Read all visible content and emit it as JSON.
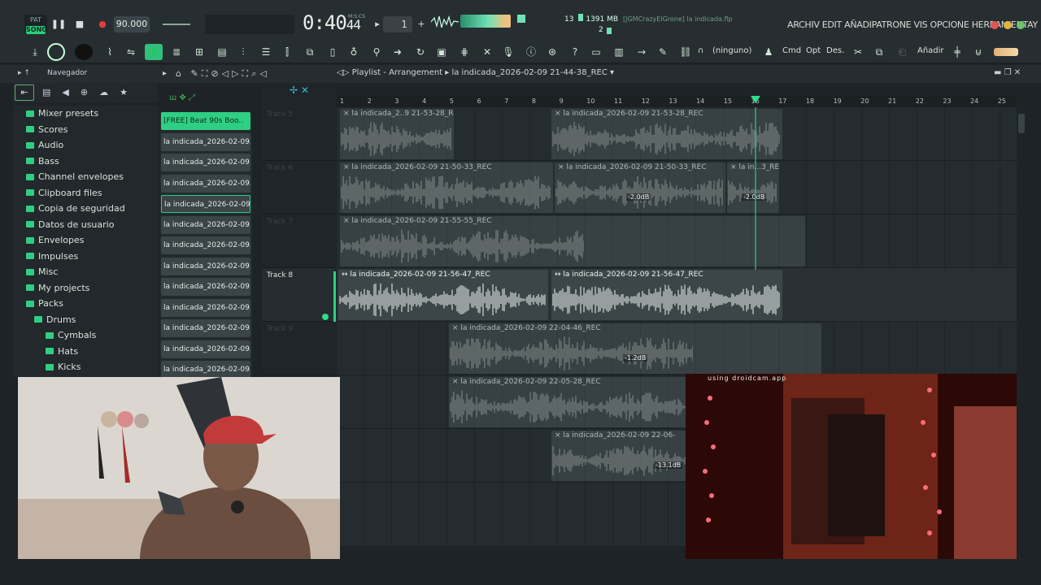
{
  "topbar": {
    "song_badge": "SONG",
    "pat_label": "PAT",
    "tempo": "90.000",
    "time": "0:40",
    "time_frac": "44",
    "time_unit": "M:S:CS",
    "pattern_num": "1",
    "cpu_val": "13",
    "mem": "1391 MB",
    "voices": "2",
    "hint": "[JGMCrazyElGrone] la indicada.flp",
    "menu": "ARCHIV EDIT AÑADIPATRONE VIS OPCIONE HERRAMIENTAY"
  },
  "toolbar": {
    "preset": "(ninguno)",
    "cmd": "Cmd",
    "opt": "Opt",
    "des": "Des.",
    "add": "Añadir"
  },
  "nav": {
    "label": "Navegador",
    "playlist": "Playlist - Arrangement",
    "crumb": "la indicada_2026-02-09 21-44-38_REC"
  },
  "browser": [
    "Mixer presets",
    "Scores",
    "Audio",
    "Bass",
    "Channel envelopes",
    "Clipboard files",
    "Copia de seguridad",
    "Datos de usuario",
    "Envelopes",
    "Impulses",
    "Misc",
    "My projects",
    "Packs",
    "Drums",
    "Cymbals",
    "Hats",
    "Kicks"
  ],
  "patterns": [
    "[FREE] Beat 90s Boo..",
    "la indicada_2026-02-09..",
    "la indicada_2026-02-09..",
    "la indicada_2026-02-09..",
    "la indicada_2026-02-09..",
    "la indicada_2026-02-09..",
    "la indicada_2026-02-09..",
    "la indicada_2026-02-09..",
    "la indicada_2026-02-09..",
    "la indicada_2026-02-09..",
    "la indicada_2026-02-09..",
    "la indicada_2026-02-09..",
    "la indicada_2026-02-09.."
  ],
  "tracks": [
    "Track 5",
    "Track 6",
    "Track 7",
    "Track 8",
    "Track 9",
    "",
    ""
  ],
  "ruler": [
    "1",
    "2",
    "3",
    "4",
    "5",
    "6",
    "7",
    "8",
    "9",
    "10",
    "11",
    "12",
    "13",
    "14",
    "15",
    "16",
    "17",
    "18",
    "19",
    "20",
    "21",
    "22",
    "23",
    "24",
    "25"
  ],
  "clips": {
    "l0a": "× la indicada_2..9 21-53-28_REC",
    "l0b": "× la indicada_2026-02-09 21-53-28_REC",
    "l1a": "× la indicada_2026-02-09 21-50-33_REC",
    "l1b": "× la indicada_2026-02-09 21-50-33_REC",
    "l1c": "× la in...3_REC",
    "l2a": "× la indicada_2026-02-09 21-55-55_REC",
    "l3a": "↔ la indicada_2026-02-09 21-56-47_REC",
    "l3b": "↔ la indicada_2026-02-09 21-56-47_REC",
    "l4a": "× la indicada_2026-02-09 22-04-46_REC",
    "l5a": "× la indicada_2026-02-09 22-05-28_REC",
    "l6a": "× la indicada_2026-02-09 22-06-"
  },
  "gains": {
    "g1": "-2.0dB",
    "g2": "-2.0dB",
    "g3": "-1.2dB",
    "g4": "-13.1dB"
  },
  "cam2_tag": "using droidcam.app",
  "colors": {
    "accent": "#2fcf83",
    "clip_bg": "#3c4649",
    "wave": "#d9dfdc"
  }
}
